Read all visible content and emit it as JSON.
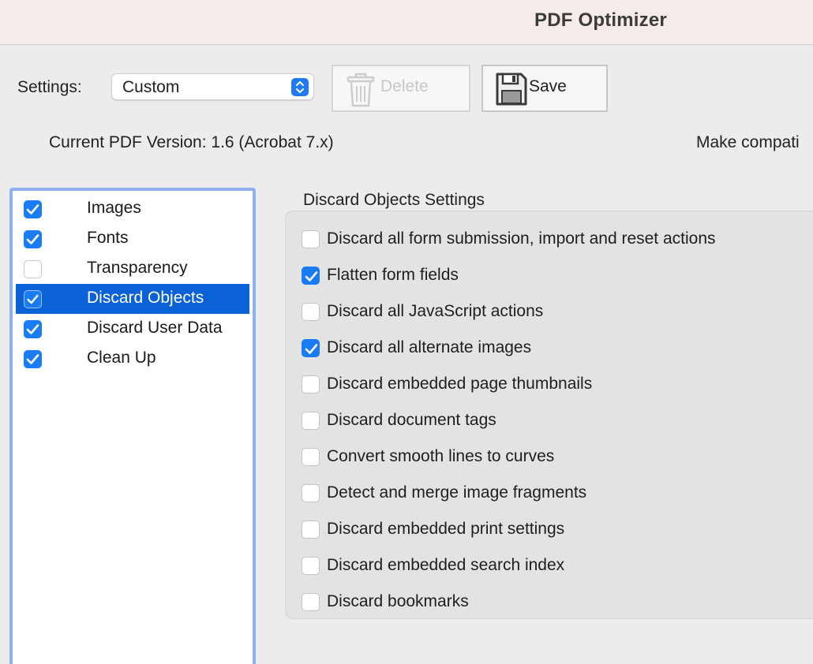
{
  "window": {
    "title": "PDF Optimizer"
  },
  "settings": {
    "label": "Settings:",
    "selected": "Custom",
    "delete_label": "Delete",
    "save_label": "Save"
  },
  "info": {
    "current_version": "Current PDF Version: 1.6 (Acrobat 7.x)",
    "make_compatible": "Make compati"
  },
  "sidebar": {
    "items": [
      {
        "label": "Images",
        "checked": true,
        "selected": false
      },
      {
        "label": "Fonts",
        "checked": true,
        "selected": false
      },
      {
        "label": "Transparency",
        "checked": false,
        "selected": false
      },
      {
        "label": "Discard Objects",
        "checked": true,
        "selected": true
      },
      {
        "label": "Discard User Data",
        "checked": true,
        "selected": false
      },
      {
        "label": "Clean Up",
        "checked": true,
        "selected": false
      }
    ]
  },
  "discard_objects": {
    "title": "Discard Objects Settings",
    "options": [
      {
        "label": "Discard all form submission, import and reset actions",
        "checked": false
      },
      {
        "label": "Flatten form fields",
        "checked": true
      },
      {
        "label": "Discard all JavaScript actions",
        "checked": false
      },
      {
        "label": "Discard all alternate images",
        "checked": true
      },
      {
        "label": "Discard embedded page thumbnails",
        "checked": false
      },
      {
        "label": "Discard document tags",
        "checked": false
      },
      {
        "label": "Convert smooth lines to curves",
        "checked": false
      },
      {
        "label": "Detect and merge image fragments",
        "checked": false
      },
      {
        "label": "Discard embedded print settings",
        "checked": false
      },
      {
        "label": "Discard embedded search index",
        "checked": false
      },
      {
        "label": "Discard bookmarks",
        "checked": false
      }
    ]
  },
  "colors": {
    "accent": "#1a7cf5",
    "selection": "#0b62d6",
    "titlebar": "#f7eaea"
  }
}
